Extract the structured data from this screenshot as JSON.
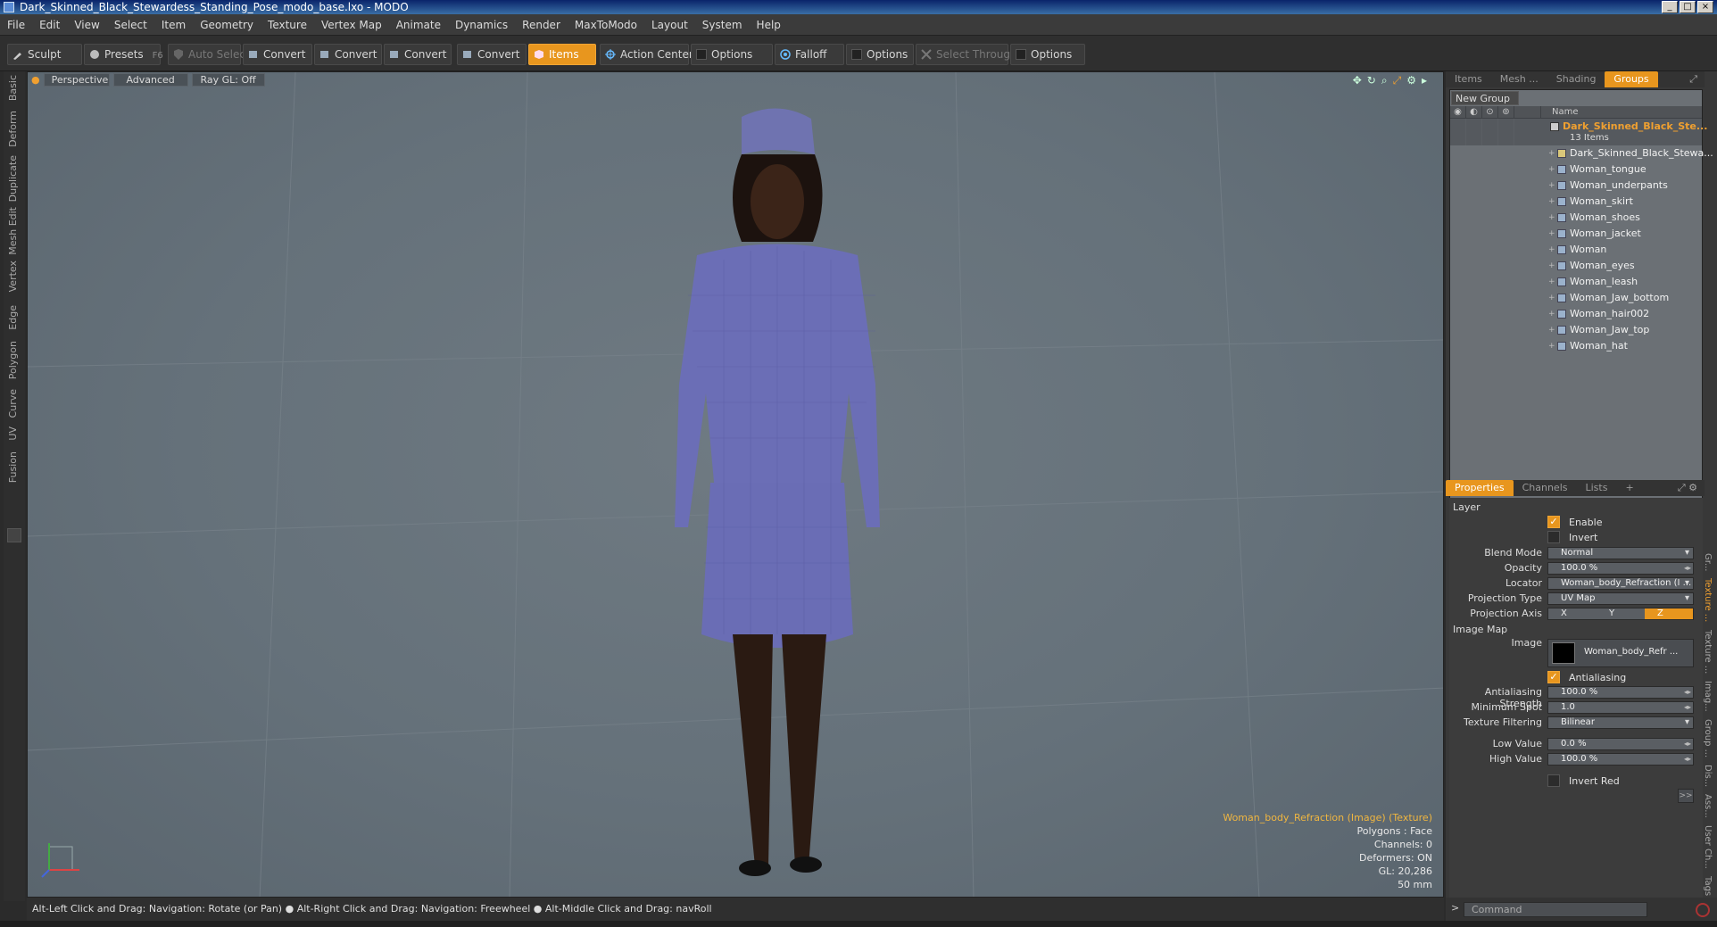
{
  "window": {
    "title": "Dark_Skinned_Black_Stewardess_Standing_Pose_modo_base.lxo - MODO"
  },
  "menu": [
    "File",
    "Edit",
    "View",
    "Select",
    "Item",
    "Geometry",
    "Texture",
    "Vertex Map",
    "Animate",
    "Dynamics",
    "Render",
    "MaxToModo",
    "Layout",
    "System",
    "Help"
  ],
  "toolbar": {
    "sculpt": "Sculpt",
    "presets": "Presets",
    "presets_key": "F6",
    "auto_select": "Auto Select",
    "convert1": "Convert",
    "convert2": "Convert",
    "convert3": "Convert",
    "convert4": "Convert",
    "items": "Items",
    "action_center": "Action Center",
    "options1": "Options",
    "falloff": "Falloff",
    "options2": "Options",
    "select_through": "Select Through",
    "options3": "Options"
  },
  "left_tabs": [
    "Basic",
    "Deform",
    "Duplicate",
    "Mesh Edit",
    "Vertex",
    "Edge",
    "Polygon",
    "Curve",
    "UV",
    "Fusion"
  ],
  "viewport": {
    "view": "Perspective",
    "advanced": "Advanced",
    "raygl": "Ray GL: Off",
    "info": {
      "selection": "Woman_body_Refraction (Image) (Texture)",
      "polygons": "Polygons : Face",
      "channels": "Channels: 0",
      "deformers": "Deformers: ON",
      "gl": "GL: 20,286",
      "focal": "50 mm"
    }
  },
  "status": "Alt-Left Click and Drag: Navigation: Rotate (or Pan) ● Alt-Right Click and Drag: Navigation: Freewheel ● Alt-Middle Click and Drag: navRoll",
  "items_panel": {
    "tabs": [
      "Items",
      "Mesh ...",
      "Shading",
      "Groups"
    ],
    "new_group": "New Group",
    "name_col": "Name",
    "group_name": "Dark_Skinned_Black_Ste...",
    "group_count": "13 Items",
    "items": [
      "Dark_Skinned_Black_Stewa...",
      "Woman_tongue",
      "Woman_underpants",
      "Woman_skirt",
      "Woman_shoes",
      "Woman_jacket",
      "Woman",
      "Woman_eyes",
      "Woman_leash",
      "Woman_Jaw_bottom",
      "Woman_hair002",
      "Woman_Jaw_top",
      "Woman_hat"
    ]
  },
  "properties": {
    "tabs": [
      "Properties",
      "Channels",
      "Lists",
      "+"
    ],
    "layer": "Layer",
    "enable": "Enable",
    "invert": "Invert",
    "blend_mode_label": "Blend Mode",
    "blend_mode": "Normal",
    "opacity_label": "Opacity",
    "opacity": "100.0 %",
    "locator_label": "Locator",
    "locator": "Woman_body_Refraction (I ...",
    "projection_type_label": "Projection Type",
    "projection_type": "UV Map",
    "projection_axis_label": "Projection Axis",
    "axis_x": "X",
    "axis_y": "Y",
    "axis_z": "Z",
    "image_map": "Image Map",
    "image_label": "Image",
    "image": "Woman_body_Refr ...",
    "antialiasing": "Antialiasing",
    "aa_strength_label": "Antialiasing Strength",
    "aa_strength": "100.0 %",
    "min_spot_label": "Minimum Spot",
    "min_spot": "1.0",
    "tex_filter_label": "Texture Filtering",
    "tex_filter": "Bilinear",
    "low_label": "Low Value",
    "low": "0.0 %",
    "high_label": "High Value",
    "high": "100.0 %",
    "invert_red": "Invert Red",
    "more": ">>"
  },
  "side_vtabs": [
    "Gr...",
    "Texture ...",
    "Texture ...",
    "Imag...",
    "Group ...",
    "Dis...",
    "Ass...",
    "User Ch...",
    "Tags"
  ],
  "command": {
    "placeholder": "Command",
    "prompt": ">"
  }
}
